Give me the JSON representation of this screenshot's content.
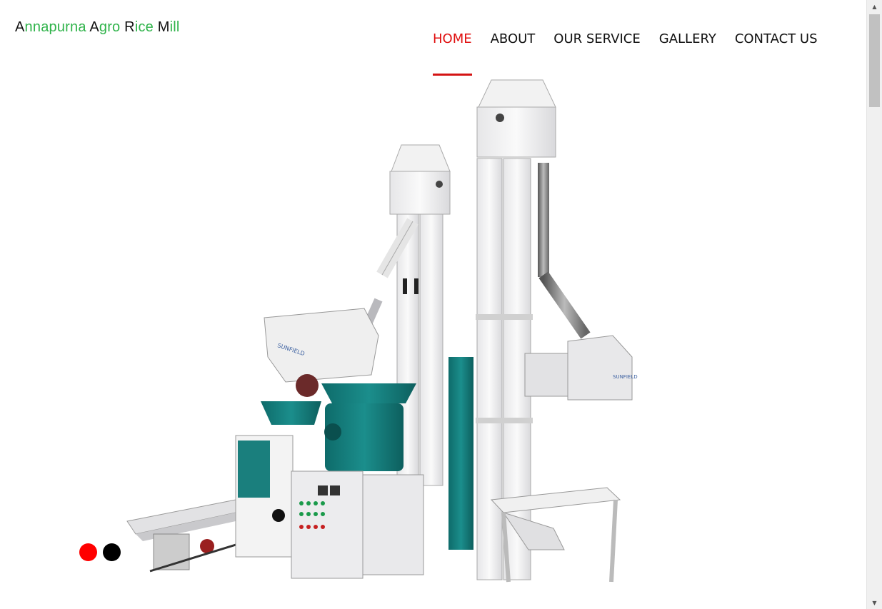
{
  "logo": {
    "words": [
      {
        "cap": "A",
        "rest": "nnapurna"
      },
      {
        "cap": "A",
        "rest": "gro"
      },
      {
        "cap": "R",
        "rest": "ice"
      },
      {
        "cap": "M",
        "rest": "ill"
      }
    ]
  },
  "nav": {
    "home": "HOME",
    "about": "ABOUT",
    "service": "OUR SERVICE",
    "gallery": "GALLERY",
    "contact": "CONTACT US"
  },
  "hero": {
    "brand_plate_left": "SUNFIELD",
    "brand_plate_right": "SUNFIELD"
  },
  "slider": {
    "slide_count": 2,
    "active_index": 0,
    "active_color": "#ff0000",
    "inactive_color": "#000000"
  },
  "colors": {
    "accent": "#e01010",
    "logo_green": "#2fb34a",
    "machine_teal": "#137d7c"
  }
}
